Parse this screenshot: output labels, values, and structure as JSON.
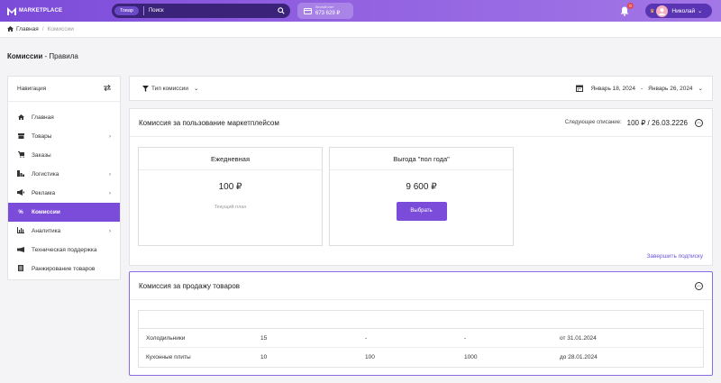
{
  "header": {
    "logo": "MARKETPLACE",
    "search_category": "Товар",
    "search_placeholder": "Поиск",
    "wallet_label": "Личный счет",
    "wallet_value": "673 629 ₽",
    "notifications_count": "0",
    "user_name": "Николай"
  },
  "breadcrumb": {
    "home": "Главная",
    "separator": "/",
    "current": "Комиссии"
  },
  "page_title": {
    "bold": "Комиссии",
    "rest": " - Правила"
  },
  "sidebar": {
    "title": "Навигация",
    "items": [
      {
        "label": "Главная",
        "icon": "home-icon"
      },
      {
        "label": "Товары",
        "icon": "box-icon"
      },
      {
        "label": "Заказы",
        "icon": "cart-icon"
      },
      {
        "label": "Логистика",
        "icon": "truck-icon"
      },
      {
        "label": "Реклама",
        "icon": "megaphone-icon"
      },
      {
        "label": "Комиссии",
        "icon": "percent-icon"
      },
      {
        "label": "Аналитика",
        "icon": "chart-icon"
      },
      {
        "label": "Техническая поддержка",
        "icon": "support-icon"
      },
      {
        "label": "Ранжирование товаров",
        "icon": "ranking-icon"
      }
    ]
  },
  "filter": {
    "type_label": "Тип комиссии",
    "date_from": "Январь 18, 2024",
    "date_sep": "-",
    "date_to": "Январь 26, 2024"
  },
  "marketplace_commission": {
    "title": "Комиссия за пользование маркетплейсом",
    "next_label": "Следующее списание:",
    "next_value": "100 ₽ / 26.03.2226",
    "plans": [
      {
        "title": "Ежедневная",
        "price": "100 ₽",
        "status": "Текущий план"
      },
      {
        "title": "Выгода \"пол года\"",
        "price": "9 600 ₽",
        "button": "Выбрать"
      }
    ],
    "finish_link": "Завершить подписку"
  },
  "sales_commission": {
    "title": "Комиссия за продажу товаров",
    "rows": [
      {
        "category": "Холодильники",
        "v1": "15",
        "v2": "-",
        "v3": "-",
        "date": "от 31.01.2024"
      },
      {
        "category": "Кухонные плиты",
        "v1": "10",
        "v2": "100",
        "v3": "1000",
        "date": "до 28.01.2024"
      }
    ]
  },
  "colors": {
    "accent": "#7b4bd9",
    "link": "#6a55d8"
  }
}
